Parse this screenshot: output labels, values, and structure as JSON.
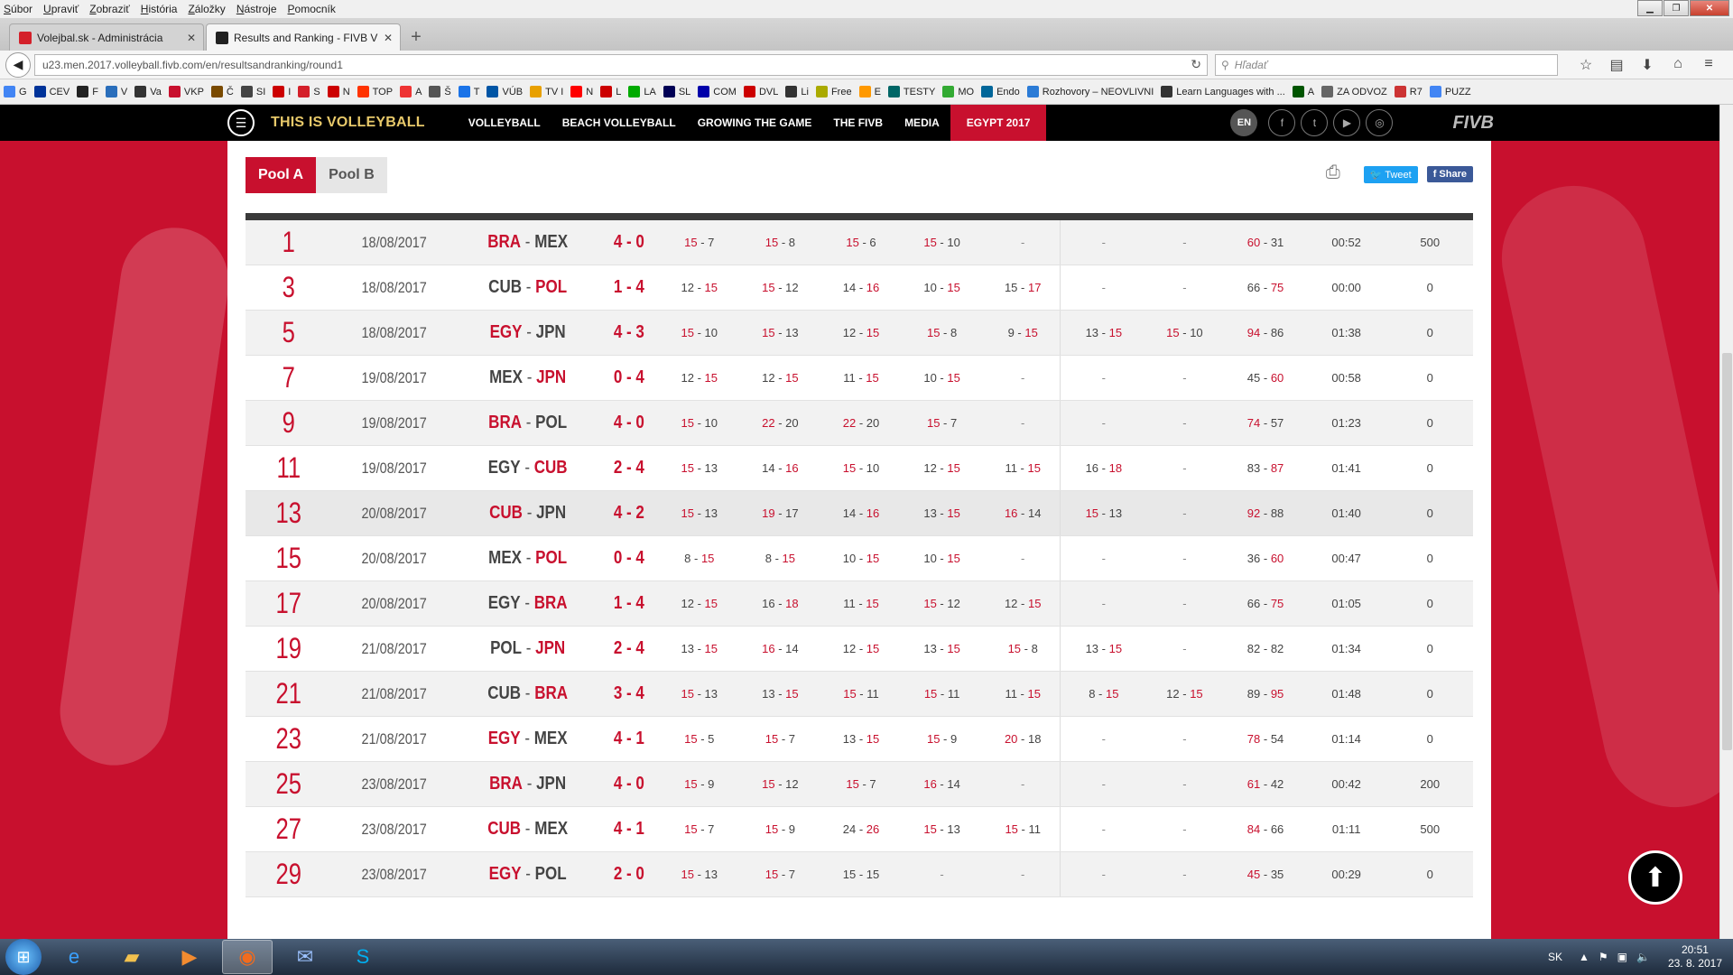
{
  "browser": {
    "menu": [
      "Súbor",
      "Upraviť",
      "Zobraziť",
      "História",
      "Záložky",
      "Nástroje",
      "Pomocník"
    ],
    "tabs": [
      {
        "title": "Volejbal.sk - Administrácia",
        "color": "#d4202a"
      },
      {
        "title": "Results and Ranking - FIVB V",
        "color": "#222222"
      }
    ],
    "url": "u23.men.2017.volleyball.fivb.com/en/resultsandranking/round1",
    "search_placeholder": "Hľadať",
    "bookmarks": [
      "G",
      "CEV",
      "F",
      "V",
      "Va",
      "VKP",
      "Č",
      "SI",
      "I",
      "S",
      "N",
      "TOP",
      "A",
      "Š",
      "T",
      "VÚB",
      "TV I",
      "N",
      "L",
      "LA",
      "SL",
      "COM",
      "DVL",
      "Li",
      "Free",
      "E",
      "TESTY",
      "MO",
      "Endo",
      "Rozhovory – NEOVLIVNI",
      "Learn Languages with ...",
      "A",
      "ZA ODVOZ",
      "R7",
      "PUZZ"
    ]
  },
  "site": {
    "brand": "THIS IS VOLLEYBALL",
    "nav": [
      "VOLLEYBALL",
      "BEACH VOLLEYBALL",
      "GROWING THE GAME",
      "THE FIVB",
      "MEDIA",
      "EGYPT 2017"
    ],
    "lang": "EN",
    "logo": "FIVB"
  },
  "pools": {
    "a": "Pool A",
    "b": "Pool B"
  },
  "share": {
    "tweet": "Tweet",
    "share": "Share"
  },
  "matches": [
    {
      "no": "1",
      "date": "18/08/2017",
      "home": "BRA",
      "away": "MEX",
      "res": "4 - 0",
      "win": "home",
      "sets": [
        [
          "15",
          "7",
          "h"
        ],
        [
          "15",
          "8",
          "h"
        ],
        [
          "15",
          "6",
          "h"
        ],
        [
          "15",
          "10",
          "h"
        ],
        [
          "-"
        ],
        [
          "-"
        ],
        [
          "-"
        ]
      ],
      "total": [
        "60",
        "31",
        "h"
      ],
      "time": "00:52",
      "spec": "500"
    },
    {
      "no": "3",
      "date": "18/08/2017",
      "home": "CUB",
      "away": "POL",
      "res": "1 - 4",
      "win": "away",
      "sets": [
        [
          "12",
          "15",
          "a"
        ],
        [
          "15",
          "12",
          "h"
        ],
        [
          "14",
          "16",
          "a"
        ],
        [
          "10",
          "15",
          "a"
        ],
        [
          "15",
          "17",
          "a"
        ],
        [
          "-"
        ],
        [
          "-"
        ]
      ],
      "total": [
        "66",
        "75",
        "a"
      ],
      "time": "00:00",
      "spec": "0"
    },
    {
      "no": "5",
      "date": "18/08/2017",
      "home": "EGY",
      "away": "JPN",
      "res": "4 - 3",
      "win": "home",
      "sets": [
        [
          "15",
          "10",
          "h"
        ],
        [
          "15",
          "13",
          "h"
        ],
        [
          "12",
          "15",
          "a"
        ],
        [
          "15",
          "8",
          "h"
        ],
        [
          "9",
          "15",
          "a"
        ],
        [
          "13",
          "15",
          "a"
        ],
        [
          "15",
          "10",
          "h"
        ]
      ],
      "total": [
        "94",
        "86",
        "h"
      ],
      "time": "01:38",
      "spec": "0"
    },
    {
      "no": "7",
      "date": "19/08/2017",
      "home": "MEX",
      "away": "JPN",
      "res": "0 - 4",
      "win": "away",
      "sets": [
        [
          "12",
          "15",
          "a"
        ],
        [
          "12",
          "15",
          "a"
        ],
        [
          "11",
          "15",
          "a"
        ],
        [
          "10",
          "15",
          "a"
        ],
        [
          "-"
        ],
        [
          "-"
        ],
        [
          "-"
        ]
      ],
      "total": [
        "45",
        "60",
        "a"
      ],
      "time": "00:58",
      "spec": "0"
    },
    {
      "no": "9",
      "date": "19/08/2017",
      "home": "BRA",
      "away": "POL",
      "res": "4 - 0",
      "win": "home",
      "sets": [
        [
          "15",
          "10",
          "h"
        ],
        [
          "22",
          "20",
          "h"
        ],
        [
          "22",
          "20",
          "h"
        ],
        [
          "15",
          "7",
          "h"
        ],
        [
          "-"
        ],
        [
          "-"
        ],
        [
          "-"
        ]
      ],
      "total": [
        "74",
        "57",
        "h"
      ],
      "time": "01:23",
      "spec": "0"
    },
    {
      "no": "11",
      "date": "19/08/2017",
      "home": "EGY",
      "away": "CUB",
      "res": "2 - 4",
      "win": "away",
      "sets": [
        [
          "15",
          "13",
          "h"
        ],
        [
          "14",
          "16",
          "a"
        ],
        [
          "15",
          "10",
          "h"
        ],
        [
          "12",
          "15",
          "a"
        ],
        [
          "11",
          "15",
          "a"
        ],
        [
          "16",
          "18",
          "a"
        ],
        [
          "-"
        ]
      ],
      "total": [
        "83",
        "87",
        "a"
      ],
      "time": "01:41",
      "spec": "0"
    },
    {
      "no": "13",
      "date": "20/08/2017",
      "home": "CUB",
      "away": "JPN",
      "res": "4 - 2",
      "win": "home",
      "sets": [
        [
          "15",
          "13",
          "h"
        ],
        [
          "19",
          "17",
          "h"
        ],
        [
          "14",
          "16",
          "a"
        ],
        [
          "13",
          "15",
          "a"
        ],
        [
          "16",
          "14",
          "h"
        ],
        [
          "15",
          "13",
          "h"
        ],
        [
          "-"
        ]
      ],
      "total": [
        "92",
        "88",
        "h"
      ],
      "time": "01:40",
      "spec": "0"
    },
    {
      "no": "15",
      "date": "20/08/2017",
      "home": "MEX",
      "away": "POL",
      "res": "0 - 4",
      "win": "away",
      "sets": [
        [
          "8",
          "15",
          "a"
        ],
        [
          "8",
          "15",
          "a"
        ],
        [
          "10",
          "15",
          "a"
        ],
        [
          "10",
          "15",
          "a"
        ],
        [
          "-"
        ],
        [
          "-"
        ],
        [
          "-"
        ]
      ],
      "total": [
        "36",
        "60",
        "a"
      ],
      "time": "00:47",
      "spec": "0"
    },
    {
      "no": "17",
      "date": "20/08/2017",
      "home": "EGY",
      "away": "BRA",
      "res": "1 - 4",
      "win": "away",
      "sets": [
        [
          "12",
          "15",
          "a"
        ],
        [
          "16",
          "18",
          "a"
        ],
        [
          "11",
          "15",
          "a"
        ],
        [
          "15",
          "12",
          "h"
        ],
        [
          "12",
          "15",
          "a"
        ],
        [
          "-"
        ],
        [
          "-"
        ]
      ],
      "total": [
        "66",
        "75",
        "a"
      ],
      "time": "01:05",
      "spec": "0"
    },
    {
      "no": "19",
      "date": "21/08/2017",
      "home": "POL",
      "away": "JPN",
      "res": "2 - 4",
      "win": "away",
      "sets": [
        [
          "13",
          "15",
          "a"
        ],
        [
          "16",
          "14",
          "h"
        ],
        [
          "12",
          "15",
          "a"
        ],
        [
          "13",
          "15",
          "a"
        ],
        [
          "15",
          "8",
          "h"
        ],
        [
          "13",
          "15",
          "a"
        ],
        [
          "-"
        ]
      ],
      "total": [
        "82",
        "82",
        "n"
      ],
      "time": "01:34",
      "spec": "0"
    },
    {
      "no": "21",
      "date": "21/08/2017",
      "home": "CUB",
      "away": "BRA",
      "res": "3 - 4",
      "win": "away",
      "sets": [
        [
          "15",
          "13",
          "h"
        ],
        [
          "13",
          "15",
          "a"
        ],
        [
          "15",
          "11",
          "h"
        ],
        [
          "15",
          "11",
          "h"
        ],
        [
          "11",
          "15",
          "a"
        ],
        [
          "8",
          "15",
          "a"
        ],
        [
          "12",
          "15",
          "a"
        ]
      ],
      "total": [
        "89",
        "95",
        "a"
      ],
      "time": "01:48",
      "spec": "0"
    },
    {
      "no": "23",
      "date": "21/08/2017",
      "home": "EGY",
      "away": "MEX",
      "res": "4 - 1",
      "win": "home",
      "sets": [
        [
          "15",
          "5",
          "h"
        ],
        [
          "15",
          "7",
          "h"
        ],
        [
          "13",
          "15",
          "a"
        ],
        [
          "15",
          "9",
          "h"
        ],
        [
          "20",
          "18",
          "h"
        ],
        [
          "-"
        ],
        [
          "-"
        ]
      ],
      "total": [
        "78",
        "54",
        "h"
      ],
      "time": "01:14",
      "spec": "0"
    },
    {
      "no": "25",
      "date": "23/08/2017",
      "home": "BRA",
      "away": "JPN",
      "res": "4 - 0",
      "win": "home",
      "sets": [
        [
          "15",
          "9",
          "h"
        ],
        [
          "15",
          "12",
          "h"
        ],
        [
          "15",
          "7",
          "h"
        ],
        [
          "16",
          "14",
          "h"
        ],
        [
          "-"
        ],
        [
          "-"
        ],
        [
          "-"
        ]
      ],
      "total": [
        "61",
        "42",
        "h"
      ],
      "time": "00:42",
      "spec": "200"
    },
    {
      "no": "27",
      "date": "23/08/2017",
      "home": "CUB",
      "away": "MEX",
      "res": "4 - 1",
      "win": "home",
      "sets": [
        [
          "15",
          "7",
          "h"
        ],
        [
          "15",
          "9",
          "h"
        ],
        [
          "24",
          "26",
          "a"
        ],
        [
          "15",
          "13",
          "h"
        ],
        [
          "15",
          "11",
          "h"
        ],
        [
          "-"
        ],
        [
          "-"
        ]
      ],
      "total": [
        "84",
        "66",
        "h"
      ],
      "time": "01:11",
      "spec": "500"
    },
    {
      "no": "29",
      "date": "23/08/2017",
      "home": "EGY",
      "away": "POL",
      "res": "2 - 0",
      "win": "home",
      "sets": [
        [
          "15",
          "13",
          "h"
        ],
        [
          "15",
          "7",
          "h"
        ],
        [
          "15",
          "15",
          "n"
        ],
        [
          "-"
        ],
        [
          "-"
        ],
        [
          "-"
        ],
        [
          "-"
        ]
      ],
      "total": [
        "45",
        "35",
        "h"
      ],
      "time": "00:29",
      "spec": "0"
    }
  ],
  "taskbar": {
    "lang": "SK",
    "time": "20:51",
    "date": "23. 8. 2017"
  }
}
